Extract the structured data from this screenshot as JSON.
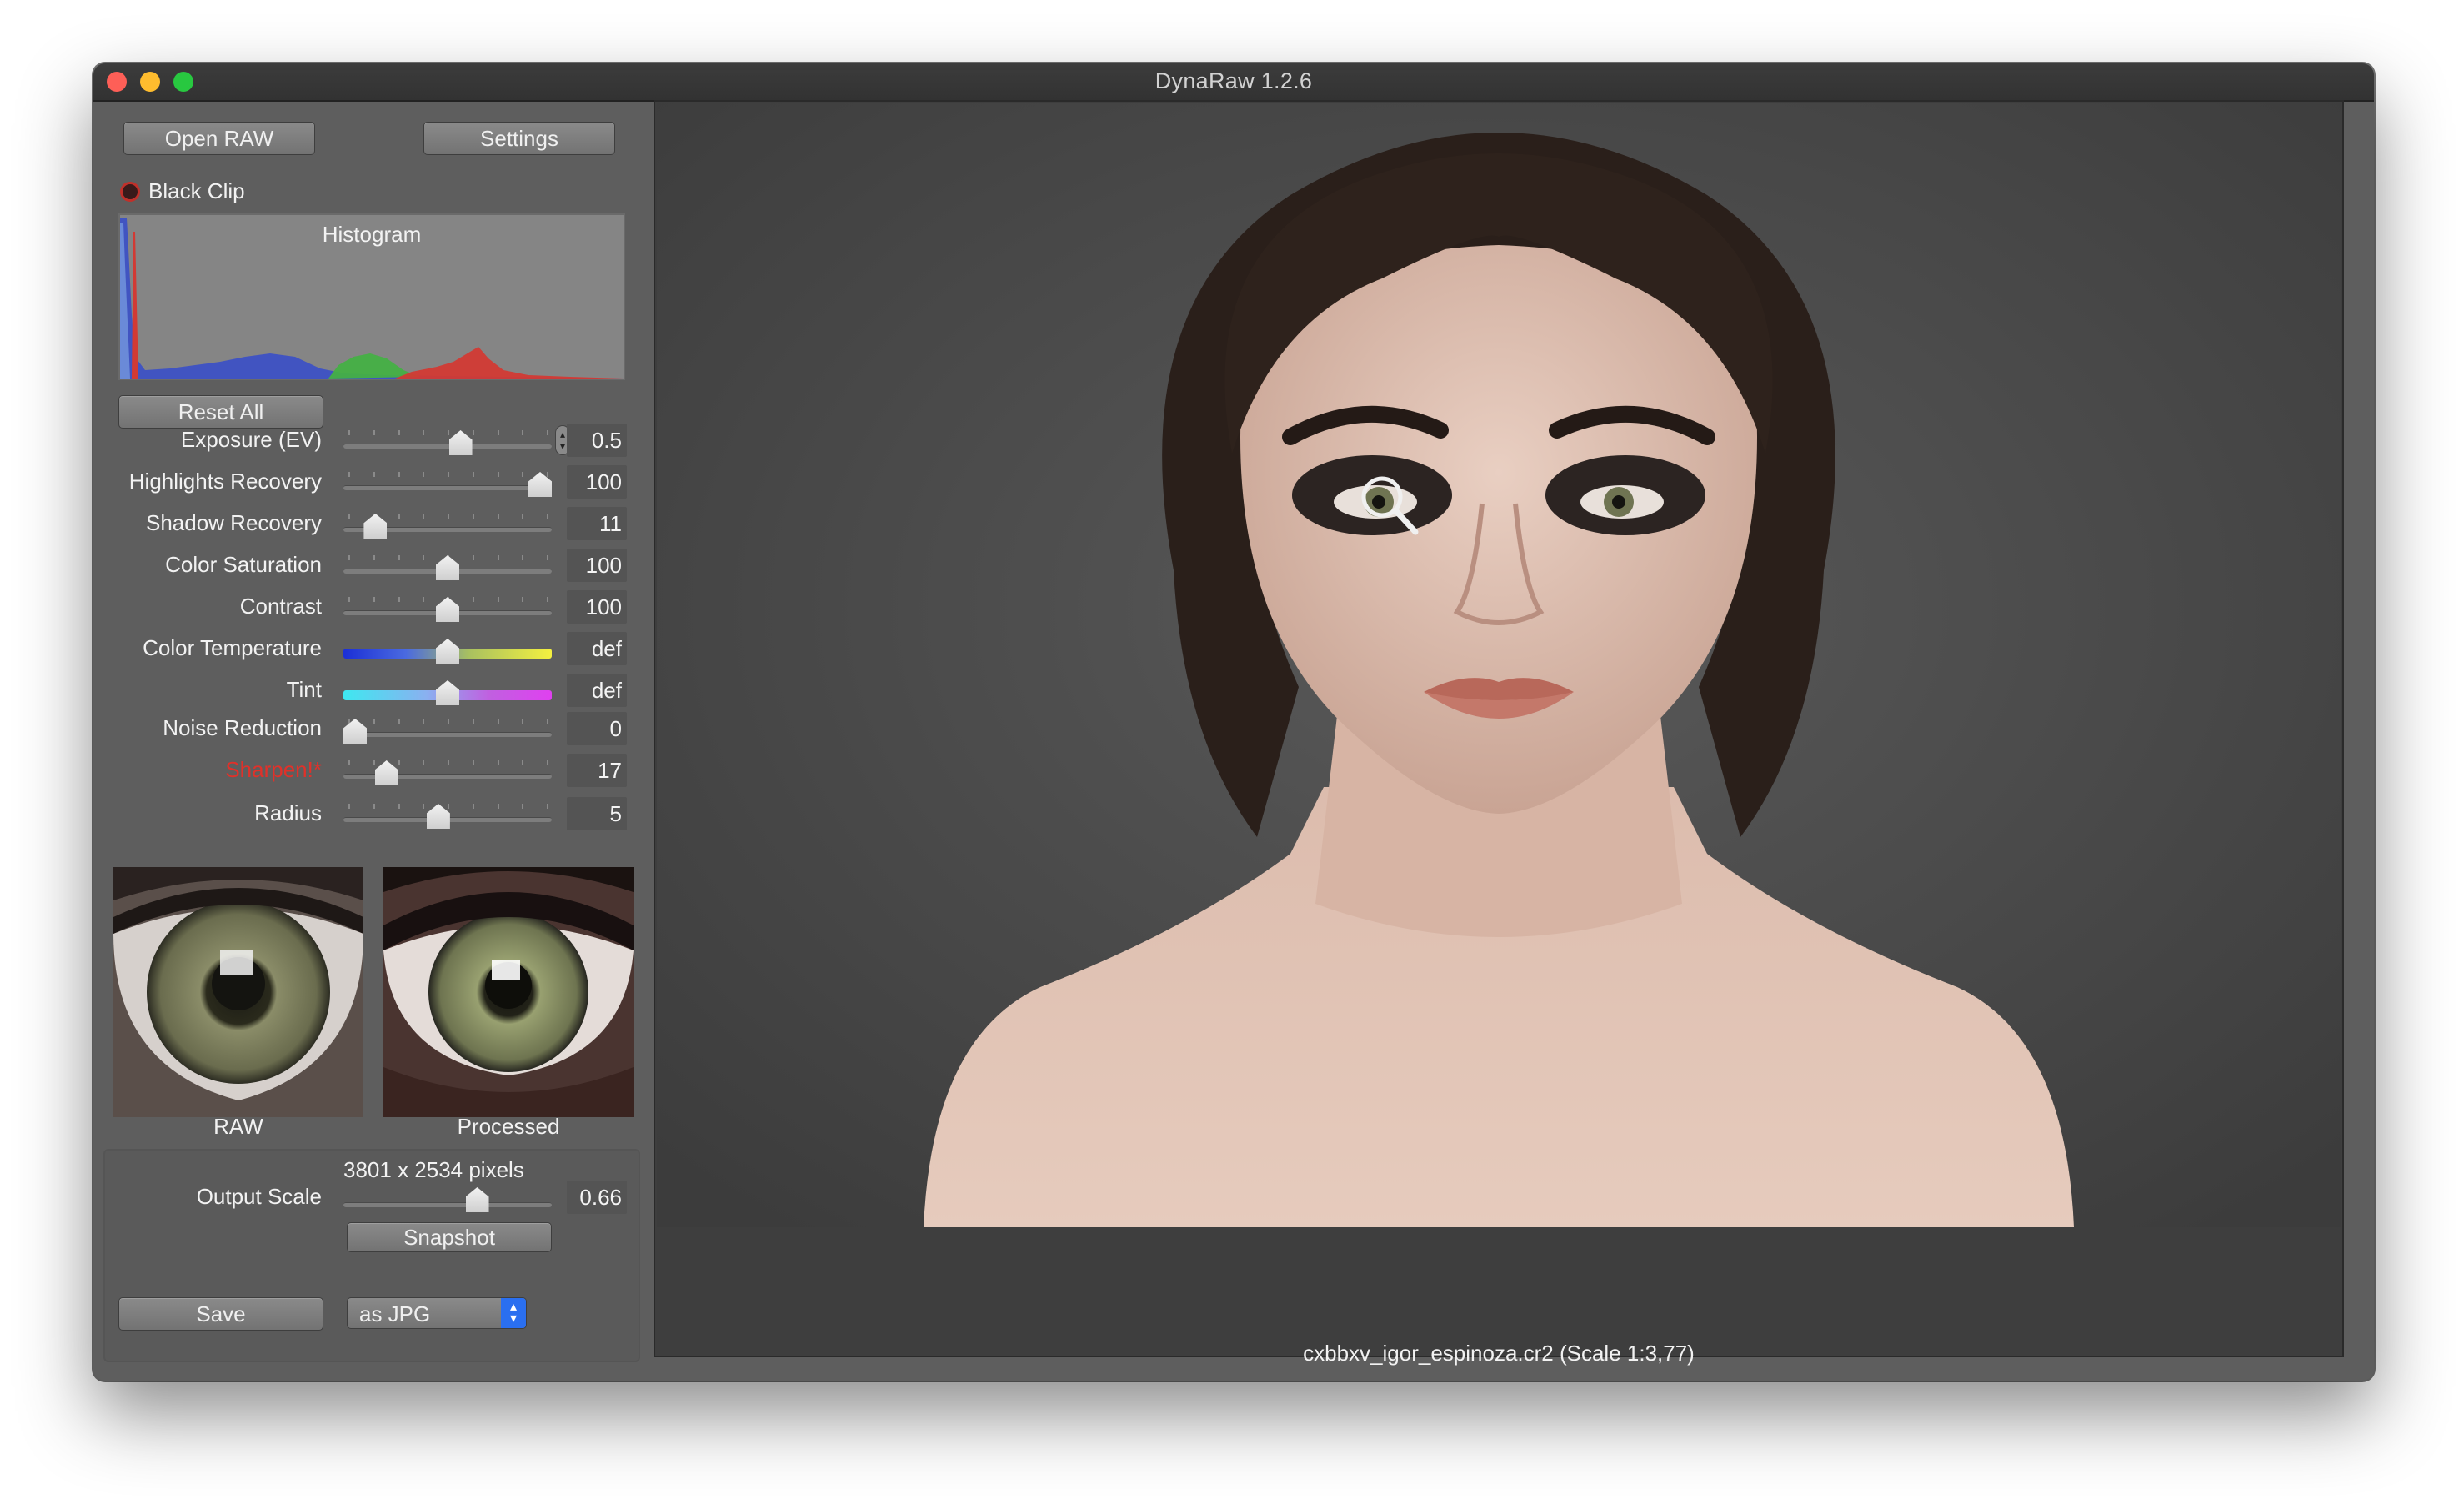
{
  "window": {
    "title": "DynaRaw 1.2.6"
  },
  "buttons": {
    "open_raw": "Open RAW",
    "settings": "Settings",
    "reset_all": "Reset All",
    "snapshot": "Snapshot",
    "save": "Save"
  },
  "black_clip": {
    "label": "Black Clip",
    "checked": false
  },
  "histogram": {
    "title": "Histogram"
  },
  "sliders": [
    {
      "label": "Exposure (EV)",
      "value": "0.5",
      "position": 0.57,
      "stepper": true
    },
    {
      "label": "Highlights Recovery",
      "value": "100",
      "position": 1.0
    },
    {
      "label": "Shadow Recovery",
      "value": "11",
      "position": 0.11
    },
    {
      "label": "Color Saturation",
      "value": "100",
      "position": 0.5
    },
    {
      "label": "Contrast",
      "value": "100",
      "position": 0.5
    },
    {
      "label": "Color Temperature",
      "value": "def",
      "position": 0.5,
      "gradient": "temperature"
    },
    {
      "label": "Tint",
      "value": "def",
      "position": 0.5,
      "gradient": "tint"
    },
    {
      "label": "Noise Reduction",
      "value": "0",
      "position": 0.0
    },
    {
      "label": "Sharpen!*",
      "value": "17",
      "position": 0.17,
      "highlight_color": "#e0312a"
    },
    {
      "label": "Radius",
      "value": "5",
      "position": 0.45
    }
  ],
  "previews": {
    "raw_label": "RAW",
    "processed_label": "Processed"
  },
  "output": {
    "label": "Output Scale",
    "pixels": "3801 x 2534 pixels",
    "scale_value": "0.66",
    "position": 0.66,
    "format": "as JPG"
  },
  "status": {
    "filename": "cxbbxv_igor_espinoza.cr2 (Scale 1:3,77)"
  },
  "colors": {
    "close": "#fe5f57",
    "minimize": "#febc2e",
    "zoom": "#28c840",
    "accent_select": "#2a6ff0"
  }
}
